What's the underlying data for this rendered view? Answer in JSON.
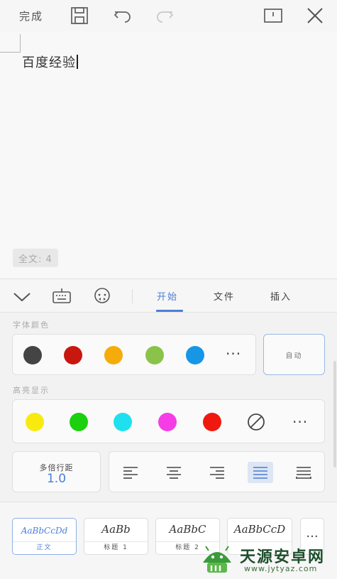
{
  "toolbar": {
    "done_label": "完成",
    "icons": [
      "save-icon",
      "undo-icon",
      "redo-icon",
      "page-view-icon",
      "close-icon"
    ]
  },
  "document": {
    "text": "百度经验",
    "word_count": "全文: 4"
  },
  "tabs": {
    "icons": [
      "collapse-chevron-icon",
      "keyboard-icon",
      "voice-assistant-icon"
    ],
    "items": [
      {
        "label": "开始",
        "active": true
      },
      {
        "label": "文件",
        "active": false
      },
      {
        "label": "插入",
        "active": false
      }
    ]
  },
  "font_color": {
    "label": "字体颜色",
    "swatches": [
      "#444444",
      "#c7170f",
      "#f5ac0b",
      "#8bc34a",
      "#1796e6"
    ],
    "more": "···",
    "auto_label": "自动"
  },
  "highlight": {
    "label": "高亮显示",
    "swatches": [
      "#f8ea0f",
      "#1bd00f",
      "#1fe0ee",
      "#f63ce6",
      "#f0190f"
    ],
    "none_icon": "no-color-icon",
    "more": "···"
  },
  "paragraph": {
    "line_spacing_title": "多倍行距",
    "line_spacing_value": "1.0",
    "alignments": [
      "align-left",
      "align-center",
      "align-right",
      "align-justify",
      "align-distributed"
    ],
    "selected_alignment": "align-justify"
  },
  "styles": {
    "items": [
      {
        "sample": "AaBbCcDd",
        "name": "正文",
        "selected": true
      },
      {
        "sample": "AaBb",
        "name": "标题 1",
        "selected": false
      },
      {
        "sample": "AaBbC",
        "name": "标题 2",
        "selected": false
      },
      {
        "sample": "AaBbCcD",
        "name": "",
        "selected": false
      }
    ],
    "more": "···"
  },
  "watermark": {
    "title": "天源安卓网",
    "url": "www.jytyaz.com"
  },
  "colors": {
    "accent": "#4a7fd6",
    "watermark_green": "#2e7d32"
  }
}
